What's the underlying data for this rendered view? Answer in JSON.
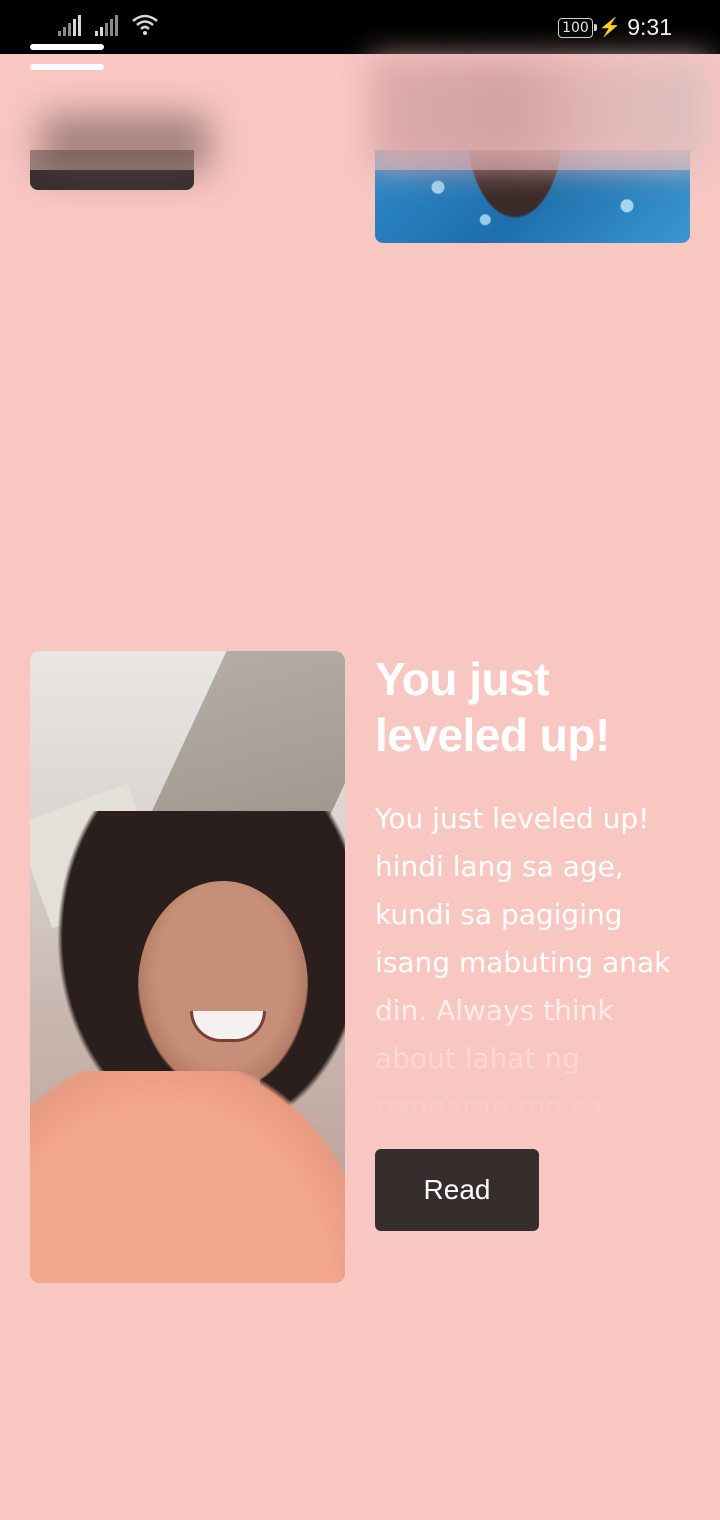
{
  "status_bar": {
    "battery": "100",
    "time": "9:31"
  },
  "header": {
    "menu_icon": "hamburger-menu-icon"
  },
  "post": {
    "title": "You just leveled up!",
    "excerpt": "You just leveled up! hindi lang sa age, kundi sa pagiging isang mabuting anak din. Always think about lahat ng pangarap mo sa",
    "read_label": "Read"
  },
  "colors": {
    "background": "#f9c7c2",
    "button": "#362d2c",
    "text": "#ffffff"
  }
}
